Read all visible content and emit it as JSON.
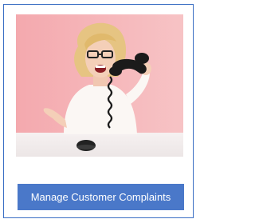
{
  "card": {
    "photo": {
      "alt": "Frustrated woman shouting into a telephone handset",
      "background_color": "#f2b3b7",
      "desk_color": "#f3eeee"
    },
    "action_button": {
      "label": "Manage Customer Complaints",
      "color": "#4a78c9",
      "text_color": "#ffffff"
    },
    "border_color": "#3b6fc4"
  }
}
